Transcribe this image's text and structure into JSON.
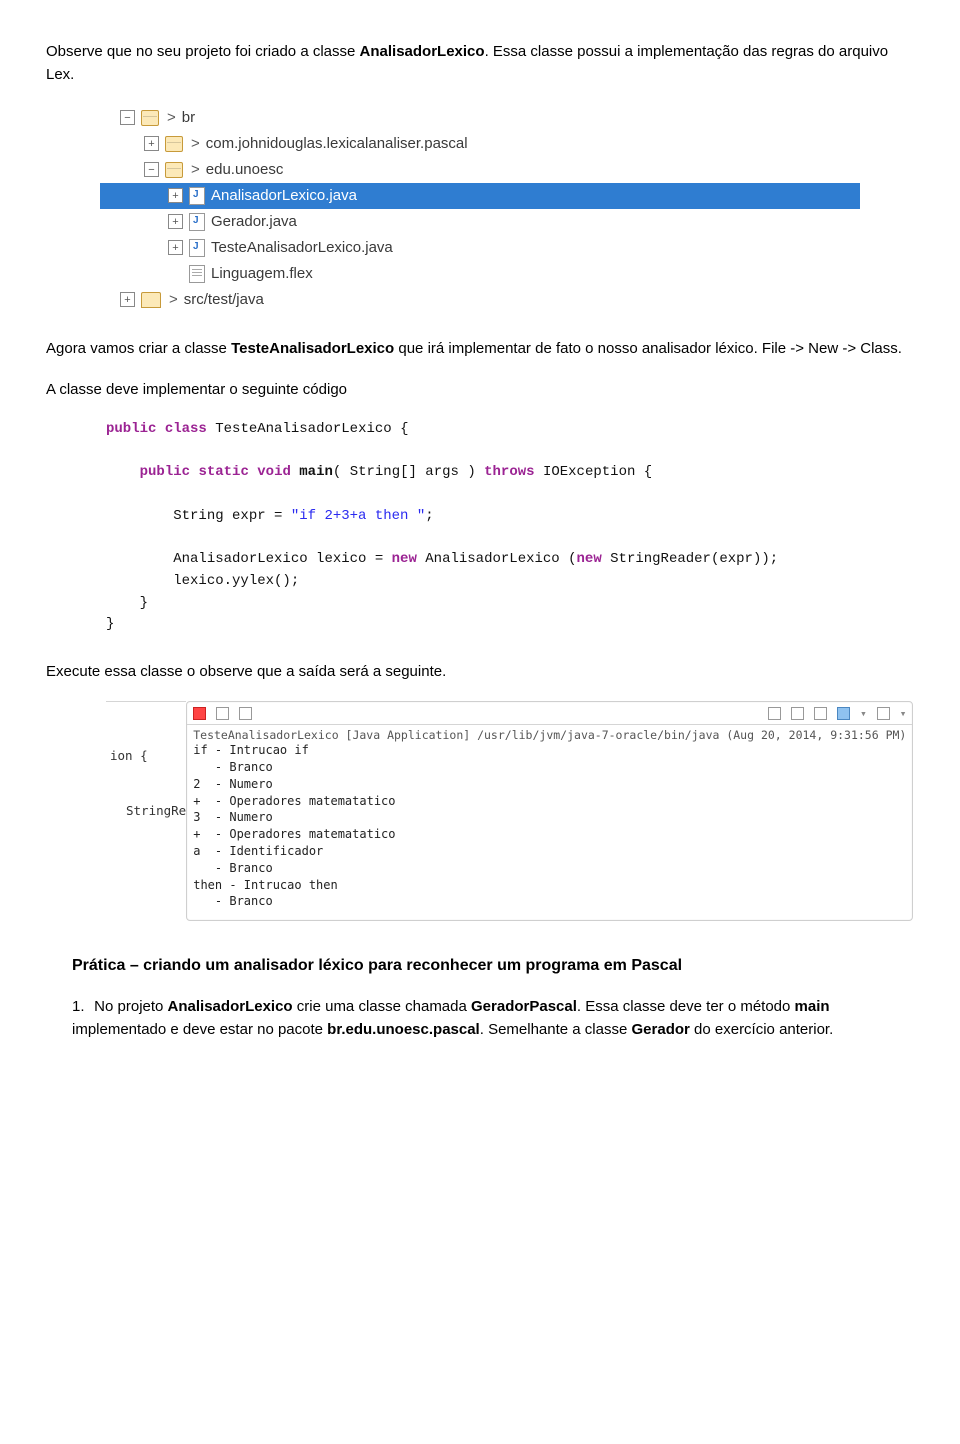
{
  "intro": {
    "p1a": "Observe que no seu projeto foi criado a classe ",
    "p1b": "AnalisadorLexico",
    "p1c": ". Essa classe possui a implementação das regras do arquivo Lex."
  },
  "tree": {
    "items": [
      {
        "level": 1,
        "toggle": "-",
        "icon": "pkg",
        "label": "br",
        "gt": true,
        "sel": false
      },
      {
        "level": 2,
        "toggle": "+",
        "icon": "pkg",
        "label": "com.johnidouglas.lexicalanaliser.pascal",
        "gt": true,
        "sel": false
      },
      {
        "level": 2,
        "toggle": "-",
        "icon": "pkg",
        "label": "edu.unoesc",
        "gt": true,
        "sel": false
      },
      {
        "level": 3,
        "toggle": "+",
        "icon": "file-j",
        "label": "AnalisadorLexico.java",
        "gt": false,
        "sel": true
      },
      {
        "level": 3,
        "toggle": "+",
        "icon": "file-j",
        "label": "Gerador.java",
        "gt": false,
        "sel": false
      },
      {
        "level": 3,
        "toggle": "+",
        "icon": "file-j",
        "label": "TesteAnalisadorLexico.java",
        "gt": false,
        "sel": false
      },
      {
        "level": 3,
        "toggle": "",
        "icon": "file-f",
        "label": "Linguagem.flex",
        "gt": false,
        "sel": false
      },
      {
        "level": 1,
        "toggle": "+",
        "icon": "folder",
        "label": "src/test/java",
        "gt": true,
        "sel": false
      }
    ]
  },
  "mid": {
    "p2a": "Agora vamos criar a classe ",
    "p2b": "TesteAnalisadorLexico",
    "p2c": " que irá implementar de fato o nosso analisador léxico. File -> New -> Class.",
    "p3": "A classe deve implementar o seguinte código"
  },
  "code": {
    "kw_public": "public",
    "kw_class": "class",
    "cls_name": "TesteAnalisadorLexico {",
    "kw_static": "static",
    "kw_void": "void",
    "main": "main",
    "sig": "( String[] args )",
    "kw_throws": "throws",
    "ioex": "IOException {",
    "line1": "String expr = ",
    "str1": "\"if 2+3+a then \"",
    "semi": ";",
    "line2a": "AnalisadorLexico lexico = ",
    "kw_new": "new",
    "line2b": " AnalisadorLexico (",
    "line2c": " StringReader(expr));",
    "line3": "lexico.yylex();",
    "brace1": "}",
    "brace2": "}"
  },
  "after_code": "Execute essa classe o observe que a saída será a seguinte.",
  "console": {
    "left_frag1": "ion {",
    "left_frag2": "StringRe",
    "header": "TesteAnalisadorLexico [Java Application] /usr/lib/jvm/java-7-oracle/bin/java (Aug 20, 2014, 9:31:56 PM)",
    "lines": [
      "if - Intrucao if",
      "   - Branco",
      "2  - Numero",
      "+  - Operadores matematatico",
      "3  - Numero",
      "+  - Operadores matematatico",
      "a  - Identificador",
      "   - Branco",
      "then - Intrucao then",
      "   - Branco"
    ]
  },
  "heading": "Prática – criando um analisador léxico para reconhecer um programa em Pascal",
  "list": {
    "num": "1.",
    "l1a": "No projeto ",
    "l1b": "AnalisadorLexico",
    "l1c": " crie uma classe chamada ",
    "l1d": "GeradorPascal",
    "l1e": ". Essa classe deve ter o método ",
    "l1f": "main",
    "l1g": " implementado e deve estar no pacote ",
    "l1h": "br.edu.unoesc.pascal",
    "l1i": ". Semelhante a classe ",
    "l1j": "Gerador",
    "l1k": " do exercício anterior."
  }
}
